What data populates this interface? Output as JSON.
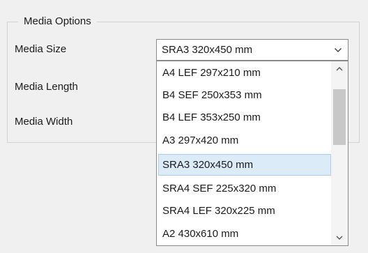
{
  "group": {
    "title": "Media Options"
  },
  "fields": {
    "media_size_label": "Media Size",
    "media_length_label": "Media Length",
    "media_width_label": "Media Width"
  },
  "combo": {
    "selected_value": "SRA3 320x450 mm"
  },
  "dropdown": {
    "options": [
      "A4 LEF 297x210 mm",
      "B4 SEF 250x353 mm",
      "B4 LEF 353x250 mm",
      "A3 297x420 mm",
      "SRA3 320x450 mm",
      "SRA4 SEF 225x320 mm",
      "SRA4 LEF 320x225 mm",
      "A2 430x610 mm"
    ],
    "selected_index": 4
  },
  "icons": {
    "combo_arrow": "chevron-down-icon",
    "scroll_up": "scroll-up-arrow-icon",
    "scroll_down": "scroll-down-arrow-icon"
  },
  "colors": {
    "background": "#f0f0f0",
    "selection_fill": "#dcebf8",
    "selection_border": "#a9cef0",
    "scroll_thumb": "#c8c8c8"
  }
}
